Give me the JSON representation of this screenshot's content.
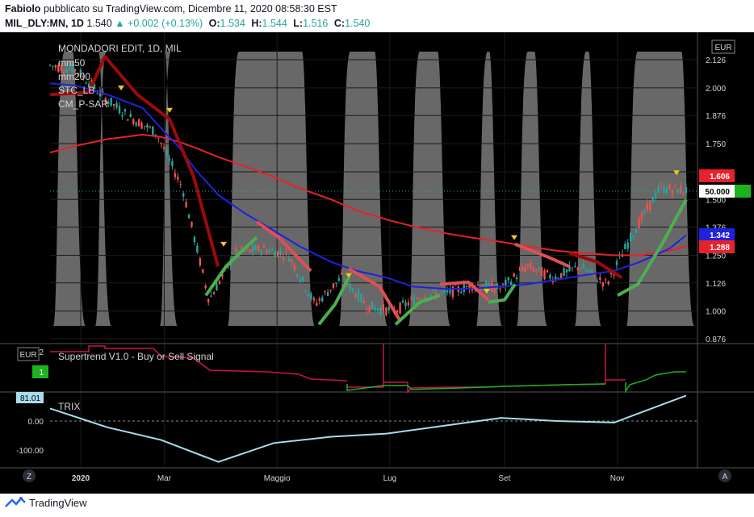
{
  "header": {
    "author": "Fabiolo",
    "published": "pubblicato su TradingView.com, Dicembre 11, 2020 08:58:30 EST",
    "symbol": "MIL_DLY:MN, 1D",
    "last": "1.540",
    "change": "+0.002 (+0.13%)",
    "o_label": "O:",
    "o": "1.534",
    "h_label": "H:",
    "h": "1.544",
    "l_label": "L:",
    "l": "1.516",
    "c_label": "C:",
    "c": "1.540"
  },
  "main_pane": {
    "title": "MONDADORI EDIT, 1D, MIL",
    "legend": [
      "mm50",
      "mm200",
      "STC_LB",
      "CM_P-SAR"
    ],
    "currency": "EUR",
    "price_ticks": [
      "2.126",
      "2.000",
      "1.876",
      "1.750",
      "1.624",
      "1.500",
      "1.376",
      "1.250",
      "1.126",
      "1.000",
      "0.876"
    ],
    "badges": [
      {
        "text": "1.606",
        "color": "#e8212b"
      },
      {
        "text": "50.000",
        "color": "#ffffff"
      },
      {
        "text": "1.342",
        "color": "#1e22e0"
      },
      {
        "text": "1.288",
        "color": "#e8212b"
      }
    ]
  },
  "supertrend_pane": {
    "title": "Supertrend V1.0 - Buy or Sell Signal",
    "currency": "EUR",
    "ticks": [
      "2",
      "1"
    ]
  },
  "trix_pane": {
    "title": "TRIX",
    "badge": "81.01",
    "ticks": [
      "0.00",
      "-100.00"
    ]
  },
  "time_axis": {
    "labels": [
      "2020",
      "Mar",
      "Maggio",
      "Lug",
      "Set",
      "Nov"
    ],
    "left_btn": "Z",
    "right_btn": "A"
  },
  "footer": {
    "brand": "TradingView"
  },
  "chart_data": [
    {
      "type": "line",
      "title": "MONDADORI EDIT, 1D, MIL",
      "x": [
        "2020-01-01",
        "2020-01-15",
        "2020-02-01",
        "2020-02-20",
        "2020-03-01",
        "2020-03-10",
        "2020-03-20",
        "2020-04-01",
        "2020-04-15",
        "2020-05-01",
        "2020-05-15",
        "2020-06-01",
        "2020-06-15",
        "2020-07-01",
        "2020-07-15",
        "2020-08-01",
        "2020-08-15",
        "2020-09-01",
        "2020-09-15",
        "2020-10-01",
        "2020-10-15",
        "2020-11-01",
        "2020-11-15",
        "2020-12-01",
        "2020-12-10"
      ],
      "series": [
        {
          "name": "mm50",
          "color": "#1e22e0",
          "values": [
            2.02,
            2.01,
            1.97,
            1.91,
            1.82,
            1.74,
            1.63,
            1.52,
            1.44,
            1.36,
            1.29,
            1.22,
            1.18,
            1.15,
            1.11,
            1.1,
            1.1,
            1.11,
            1.12,
            1.14,
            1.16,
            1.18,
            1.22,
            1.28,
            1.34
          ]
        },
        {
          "name": "mm200",
          "color": "#e8212b",
          "values": [
            1.71,
            1.74,
            1.77,
            1.79,
            1.78,
            1.76,
            1.73,
            1.69,
            1.65,
            1.6,
            1.55,
            1.5,
            1.45,
            1.41,
            1.38,
            1.35,
            1.33,
            1.31,
            1.29,
            1.27,
            1.26,
            1.25,
            1.25,
            1.27,
            1.29
          ]
        },
        {
          "name": "close",
          "color": "#26a69a",
          "values": [
            2.1,
            2.08,
            1.96,
            1.87,
            1.8,
            1.55,
            1.05,
            1.26,
            1.28,
            1.25,
            1.03,
            1.15,
            1.02,
            1.0,
            1.07,
            1.08,
            1.12,
            1.1,
            1.2,
            1.15,
            1.2,
            1.12,
            1.35,
            1.55,
            1.54
          ]
        }
      ],
      "ylim": [
        0.876,
        2.126
      ]
    },
    {
      "type": "line",
      "title": "TRIX",
      "x": [
        "2020-01-01",
        "2020-02-01",
        "2020-03-01",
        "2020-04-01",
        "2020-05-01",
        "2020-06-01",
        "2020-07-01",
        "2020-08-01",
        "2020-09-01",
        "2020-10-01",
        "2020-11-01",
        "2020-12-10"
      ],
      "series": [
        {
          "name": "TRIX",
          "color": "#a8dcec",
          "values": [
            40,
            -20,
            -60,
            -130,
            -70,
            -50,
            -40,
            -15,
            10,
            0,
            -5,
            81.01
          ]
        }
      ],
      "ylim": [
        -150,
        100
      ]
    }
  ]
}
